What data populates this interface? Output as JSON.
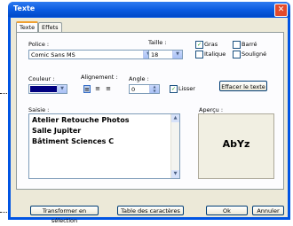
{
  "window": {
    "title": "Texte",
    "close_label": "✕"
  },
  "tabs": [
    {
      "label": "Texte"
    },
    {
      "label": "Effets"
    }
  ],
  "police": {
    "label": "Police :",
    "value": "Comic Sans MS"
  },
  "taille": {
    "label": "Taille :",
    "value": "18"
  },
  "styles": {
    "gras": {
      "label": "Gras",
      "checked": true
    },
    "barre": {
      "label": "Barré",
      "checked": false
    },
    "italique": {
      "label": "Italique",
      "checked": false
    },
    "souligne": {
      "label": "Souligné",
      "checked": false
    }
  },
  "couleur": {
    "label": "Couleur :",
    "value": "#000080"
  },
  "alignement": {
    "label": "Alignement :",
    "options": [
      "left",
      "center",
      "right"
    ],
    "selected": "left"
  },
  "angle": {
    "label": "Angle :",
    "value": "0"
  },
  "lisser": {
    "label": "Lisser",
    "checked": true
  },
  "effacer_button": "Effacer le texte",
  "saisie": {
    "label": "Saisie :",
    "lines": [
      "Atelier Retouche Photos",
      "Salle Jupiter",
      "Bâtiment Sciences C"
    ]
  },
  "apercu": {
    "label": "Aperçu :",
    "text": "AbYz"
  },
  "buttons": {
    "transformer": "Transformer en sélection",
    "table": "Table des caractères",
    "ok": "Ok",
    "annuler": "Annuler"
  },
  "colors": {
    "titlebar": "#0a5ae0",
    "dialog_bg": "#ece9d8",
    "swatch": "#000080"
  }
}
